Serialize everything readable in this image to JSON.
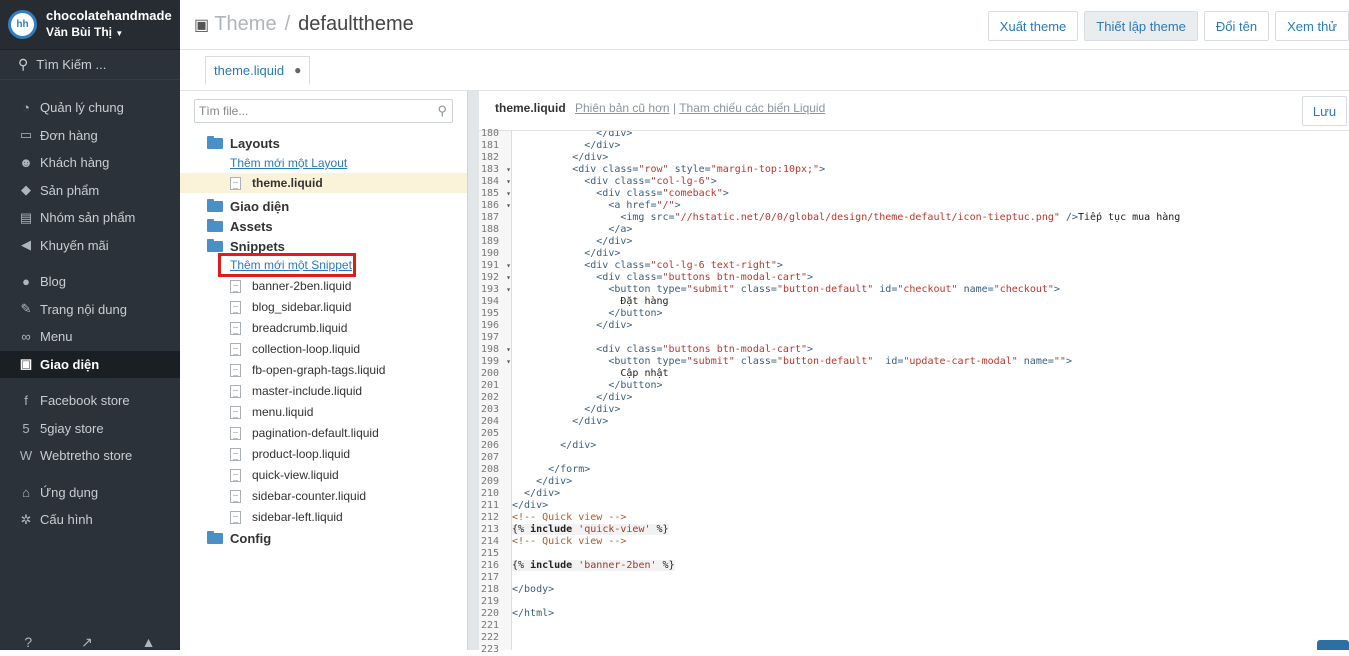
{
  "sidebar": {
    "shop_name": "chocolatehandmade",
    "user_name": "Văn Bùi Thị",
    "search_label": "Tìm Kiếm ...",
    "items": [
      {
        "label": "Quản lý chung",
        "icon": "dashboard-icon"
      },
      {
        "label": "Đơn hàng",
        "icon": "inbox-icon"
      },
      {
        "label": "Khách hàng",
        "icon": "users-icon"
      },
      {
        "label": "Sản phẩm",
        "icon": "tag-icon"
      },
      {
        "label": "Nhóm sản phẩm",
        "icon": "briefcase-icon"
      },
      {
        "label": "Khuyến mãi",
        "icon": "megaphone-icon"
      },
      {
        "label": "Blog",
        "icon": "comment-icon"
      },
      {
        "label": "Trang nội dung",
        "icon": "edit-icon"
      },
      {
        "label": "Menu",
        "icon": "link-icon"
      },
      {
        "label": "Giao diện",
        "icon": "image-icon"
      },
      {
        "label": "Facebook store",
        "icon": "facebook-icon"
      },
      {
        "label": "5giay store",
        "icon": "5giay-icon"
      },
      {
        "label": "Webtretho store",
        "icon": "webtretho-icon"
      },
      {
        "label": "Ứng dụng",
        "icon": "apps-icon"
      },
      {
        "label": "Cấu hình",
        "icon": "gear-icon"
      }
    ]
  },
  "header": {
    "breadcrumb_root": "Theme",
    "breadcrumb_current": "defaulttheme",
    "buttons": [
      "Xuất theme",
      "Thiết lập theme",
      "Đổi tên",
      "Xem thử"
    ]
  },
  "tab": {
    "label": "theme.liquid",
    "modified_marker": "●"
  },
  "tree": {
    "search_placeholder": "Tìm file...",
    "folder_layouts": "Layouts",
    "add_layout": "Thêm mới một Layout",
    "layout_file": "theme.liquid",
    "folder_giaodien": "Giao diện",
    "folder_assets": "Assets",
    "folder_snippets": "Snippets",
    "add_snippet": "Thêm mới một Snippet",
    "snippet_files": [
      "banner-2ben.liquid",
      "blog_sidebar.liquid",
      "breadcrumb.liquid",
      "collection-loop.liquid",
      "fb-open-graph-tags.liquid",
      "master-include.liquid",
      "menu.liquid",
      "pagination-default.liquid",
      "product-loop.liquid",
      "quick-view.liquid",
      "sidebar-counter.liquid",
      "sidebar-left.liquid"
    ],
    "folder_config": "Config"
  },
  "editor": {
    "filename": "theme.liquid",
    "link_old": "Phiên bản cũ hơn",
    "link_sep": " | ",
    "link_vars": "Tham chiếu các biến Liquid",
    "save_label": "Lưu",
    "line_numbers": [
      "180",
      "181",
      "182",
      "183",
      "184",
      "185",
      "186",
      "187",
      "188",
      "189",
      "190",
      "191",
      "192",
      "193",
      "194",
      "195",
      "196",
      "197",
      "198",
      "199",
      "200",
      "201",
      "202",
      "203",
      "204",
      "205",
      "206",
      "207",
      "208",
      "209",
      "210",
      "211",
      "212",
      "213",
      "214",
      "215",
      "216",
      "217",
      "218",
      "219",
      "220",
      "221",
      "222",
      "223"
    ],
    "fold_lines": [
      "183",
      "184",
      "185",
      "186",
      "191",
      "192",
      "193",
      "198",
      "199"
    ],
    "code_lines": [
      "              </div>",
      "            </div>",
      "          </div>",
      "          <div class=\"row\" style=\"margin-top:10px;\">",
      "            <div class=\"col-lg-6\">",
      "              <div class=\"comeback\">",
      "                <a href=\"/\">",
      "                  <img src=\"//hstatic.net/0/0/global/design/theme-default/icon-tieptuc.png\" />Tiếp tục mua hàng",
      "                </a>",
      "              </div>",
      "            </div>",
      "            <div class=\"col-lg-6 text-right\">",
      "              <div class=\"buttons btn-modal-cart\">",
      "                <button type=\"submit\" class=\"button-default\" id=\"checkout\" name=\"checkout\">",
      "                  Đặt hàng",
      "                </button>",
      "              </div>",
      "",
      "              <div class=\"buttons btn-modal-cart\">",
      "                <button type=\"submit\" class=\"button-default\"  id=\"update-cart-modal\" name=\"\">",
      "                  Cập nhật",
      "                </button>",
      "              </div>",
      "            </div>",
      "          </div>",
      "",
      "        </div>",
      "",
      "      </form>",
      "    </div>",
      "  </div>",
      "</div>",
      "<!-- Quick view -->",
      "{% include 'quick-view' %}",
      "<!-- Quick view -->",
      "",
      "{% include 'banner-2ben' %}",
      "",
      "</body>",
      "",
      "</html>",
      "",
      "",
      ""
    ]
  }
}
